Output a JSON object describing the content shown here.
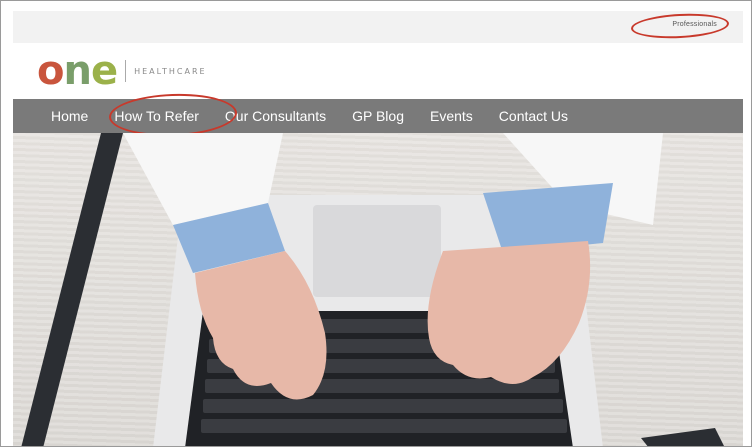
{
  "topbar": {
    "professionals_label": "Professionals"
  },
  "logo": {
    "wordmark": "one",
    "wordmark_o": "o",
    "wordmark_n": "n",
    "wordmark_e": "e",
    "subtitle": "HEALTHCARE"
  },
  "nav": {
    "items": [
      {
        "label": "Home"
      },
      {
        "label": "How To Refer"
      },
      {
        "label": "Our Consultants"
      },
      {
        "label": "GP Blog"
      },
      {
        "label": "Events"
      },
      {
        "label": "Contact Us"
      }
    ]
  },
  "colors": {
    "annotation_circle": "#c8392b",
    "nav_background": "#7a7a7a",
    "logo_o": "#c9553d",
    "logo_n": "#7a9e6a",
    "logo_e": "#9bb14a"
  }
}
